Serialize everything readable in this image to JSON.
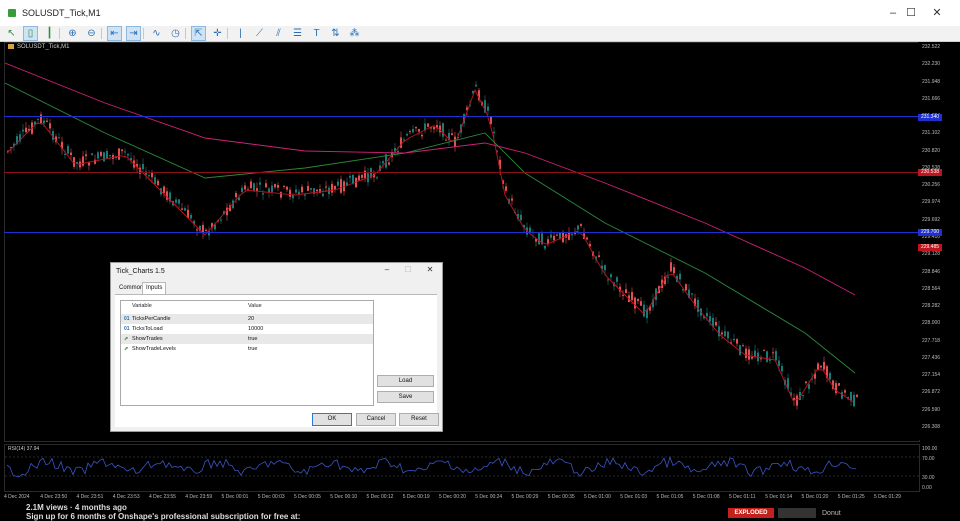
{
  "window": {
    "title": "SOLUSDT_Tick,M1"
  },
  "toolbar": {
    "tools": [
      {
        "name": "cursor-tool",
        "glyph": "↖",
        "active": false
      },
      {
        "name": "bar-chart-icon",
        "glyph": "▯",
        "active": true
      },
      {
        "name": "candles-icon",
        "glyph": "┃",
        "active": false
      },
      {
        "name": "zoom-in-icon",
        "glyph": "⊕",
        "active": false
      },
      {
        "name": "zoom-out-icon",
        "glyph": "⊖",
        "active": false
      },
      {
        "name": "autoscroll-icon",
        "glyph": "⇤",
        "active": true
      },
      {
        "name": "chart-shift-icon",
        "glyph": "⇥",
        "active": true
      },
      {
        "name": "indicators-icon",
        "glyph": "∿",
        "active": false
      },
      {
        "name": "periods-icon",
        "glyph": "◷",
        "active": false
      },
      {
        "name": "crosshair-icon",
        "glyph": "⇱",
        "active": true
      },
      {
        "name": "cross-icon",
        "glyph": "✛",
        "active": false
      },
      {
        "name": "vertical-line-icon",
        "glyph": "|",
        "active": false
      },
      {
        "name": "trendline-icon",
        "glyph": "⟋",
        "active": false
      },
      {
        "name": "channel-icon",
        "glyph": "⫽",
        "active": false
      },
      {
        "name": "fibonacci-icon",
        "glyph": "☰",
        "active": false
      },
      {
        "name": "text-icon",
        "glyph": "T",
        "active": false
      },
      {
        "name": "arrows-icon",
        "glyph": "⇅",
        "active": false
      },
      {
        "name": "shapes-icon",
        "glyph": "⁂",
        "active": false
      }
    ]
  },
  "chart": {
    "symbol_label": "SOLUSDT_Tick,M1",
    "price_ticks": [
      "232.522",
      "232.230",
      "231.948",
      "231.666",
      "231.384",
      "231.102",
      "230.820",
      "230.538",
      "230.256",
      "229.974",
      "229.692",
      "229.410",
      "229.128",
      "228.846",
      "228.564",
      "228.282",
      "228.000",
      "227.718",
      "227.436",
      "227.154",
      "226.872",
      "226.590",
      "226.308"
    ],
    "price_tags": [
      {
        "label": "231.340",
        "color": "#1f2fd0"
      },
      {
        "label": "230.538",
        "color": "#c0141e"
      },
      {
        "label": "229.700",
        "color": "#1f2fd0"
      },
      {
        "label": "229.485",
        "color": "#c0141e"
      }
    ],
    "sub_label": "RSI(14) 37.94",
    "sub_ticks": [
      "100.00",
      "70.00",
      "30.00",
      "0.00"
    ],
    "time_ticks": [
      "4 Dec 2024",
      "4 Dec 23:50",
      "4 Dec 23:51",
      "4 Dec 23:53",
      "4 Dec 23:55",
      "4 Dec 23:59",
      "5 Dec 00:01",
      "5 Dec 00:03",
      "5 Dec 00:05",
      "5 Dec 00:10",
      "5 Dec 00:12",
      "5 Dec 00:19",
      "5 Dec 00:20",
      "5 Dec 00:24",
      "5 Dec 00:29",
      "5 Dec 00:35",
      "5 Dec 01:00",
      "5 Dec 01:03",
      "5 Dec 01:05",
      "5 Dec 01:08",
      "5 Dec 01:11",
      "5 Dec 01:14",
      "5 Dec 01:20",
      "5 Dec 01:25",
      "5 Dec 01:29"
    ]
  },
  "dialog": {
    "title": "Tick_Charts 1.5",
    "tabs": [
      "Common",
      "Inputs"
    ],
    "columns": {
      "variable": "Variable",
      "value": "Value"
    },
    "rows": [
      {
        "type": "01",
        "variable": "TicksPerCandle",
        "value": "20"
      },
      {
        "type": "01",
        "variable": "TicksToLoad",
        "value": "10000"
      },
      {
        "type": "⇗",
        "variable": "ShowTrades",
        "value": "true"
      },
      {
        "type": "⇗",
        "variable": "ShowTradeLevels",
        "value": "true"
      }
    ],
    "load_label": "Load",
    "save_label": "Save",
    "ok_label": "OK",
    "cancel_label": "Cancel",
    "reset_label": "Reset"
  },
  "footer": {
    "views": "2.1M views · 4 months ago",
    "promo": "Sign up for 6 months of Onshape's professional subscription for free at:",
    "thumb_label": "EXPLODED",
    "thumb2_label": "Donut"
  },
  "colors": {
    "bull": "#1a7a7a",
    "bear": "#e05050",
    "ma_fast": "#c0141e",
    "ma_mid": "#2a8a3a",
    "ma_slow": "#d0207a",
    "level_blue": "#1f2fd0",
    "level_red": "#c0141e",
    "rsi": "#3a55c8"
  }
}
